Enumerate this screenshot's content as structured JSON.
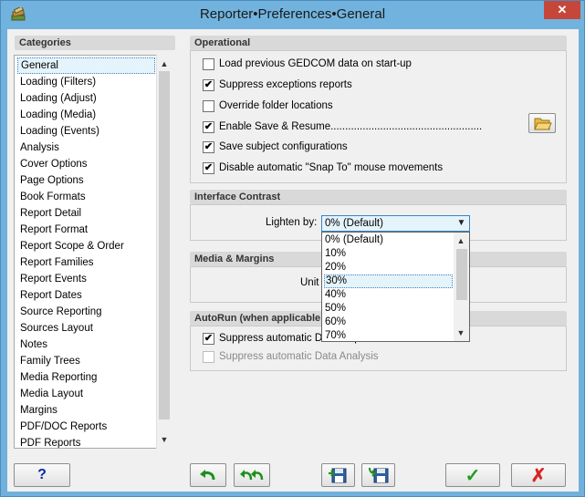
{
  "window": {
    "title": "Reporter•Preferences•General",
    "close_label": "✕"
  },
  "categories": {
    "header": "Categories",
    "items": [
      "General",
      "Loading (Filters)",
      "Loading (Adjust)",
      "Loading (Media)",
      "Loading (Events)",
      "Analysis",
      "Cover Options",
      "Page Options",
      "Book Formats",
      "Report Detail",
      "Report Format",
      "Report Scope & Order",
      "Report Families",
      "Report Events",
      "Report Dates",
      "Source Reporting",
      "Sources Layout",
      "Notes",
      "Family Trees",
      "Media Reporting",
      "Media Layout",
      "Margins",
      "PDF/DOC Reports",
      "PDF Reports"
    ],
    "selected": "General"
  },
  "operational": {
    "header": "Operational",
    "options": [
      {
        "label": "Load previous GEDCOM data on start-up",
        "checked": ""
      },
      {
        "label": "Suppress exceptions reports",
        "checked": "✔"
      },
      {
        "label": "Override folder locations",
        "checked": ""
      },
      {
        "label": "Enable Save & Resume....................................................",
        "checked": "✔"
      },
      {
        "label": "Save subject configurations",
        "checked": "✔"
      },
      {
        "label": "Disable automatic \"Snap To\" mouse movements",
        "checked": "✔"
      }
    ]
  },
  "interface_contrast": {
    "header": "Interface Contrast",
    "lighten_label": "Lighten by:",
    "lighten_value": "0% (Default)",
    "options": [
      "0% (Default)",
      "10%",
      "20%",
      "30%",
      "40%",
      "50%",
      "60%",
      "70%"
    ],
    "highlighted": "30%"
  },
  "media_margins": {
    "header": "Media & Margins",
    "units_label": "Unit"
  },
  "autorun": {
    "header": "AutoRun (when applicable",
    "options": [
      {
        "label": "Suppress automatic DOC Report",
        "checked": "✔",
        "disabled": false
      },
      {
        "label": "Suppress automatic Data Analysis",
        "checked": "",
        "disabled": true
      }
    ]
  },
  "buttons": {
    "help": "?",
    "ok": "✓",
    "cancel": "✗"
  },
  "colors": {
    "title_bar": "#71b3de",
    "close": "#c7463a",
    "ok_green": "#1f9c1f",
    "cancel_red": "#d92323",
    "highlight": "#e5f4fb"
  }
}
